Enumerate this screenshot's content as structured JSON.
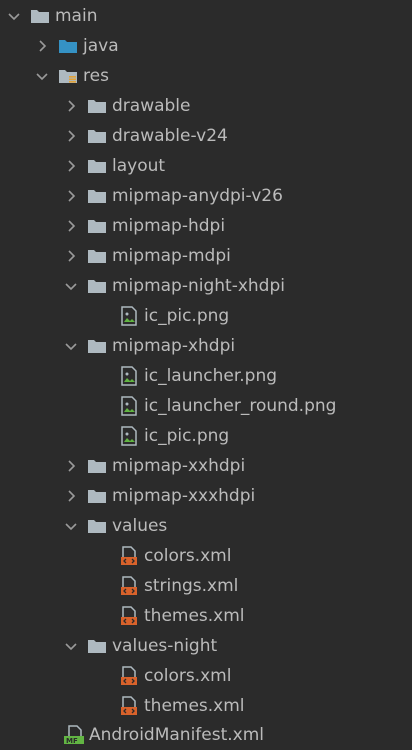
{
  "tree": {
    "main": "main",
    "java": "java",
    "res": "res",
    "drawable": "drawable",
    "drawable_v24": "drawable-v24",
    "layout": "layout",
    "mipmap_anydpi_v26": "mipmap-anydpi-v26",
    "mipmap_hdpi": "mipmap-hdpi",
    "mipmap_mdpi": "mipmap-mdpi",
    "mipmap_night_xhdpi": "mipmap-night-xhdpi",
    "night_ic_pic": "ic_pic.png",
    "mipmap_xhdpi": "mipmap-xhdpi",
    "xhdpi_ic_launcher": "ic_launcher.png",
    "xhdpi_ic_launcher_round": "ic_launcher_round.png",
    "xhdpi_ic_pic": "ic_pic.png",
    "mipmap_xxhdpi": "mipmap-xxhdpi",
    "mipmap_xxxhdpi": "mipmap-xxxhdpi",
    "values": "values",
    "values_colors": "colors.xml",
    "values_strings": "strings.xml",
    "values_themes": "themes.xml",
    "values_night": "values-night",
    "night_colors": "colors.xml",
    "night_themes": "themes.xml",
    "manifest": "AndroidManifest.xml"
  },
  "colors": {
    "background": "#2b2b2b",
    "text": "#bbbbbb",
    "folder": "#aeb9c0",
    "java_folder": "#3592c4",
    "xml_orange": "#d8622b",
    "manifest_green": "#62b543"
  }
}
